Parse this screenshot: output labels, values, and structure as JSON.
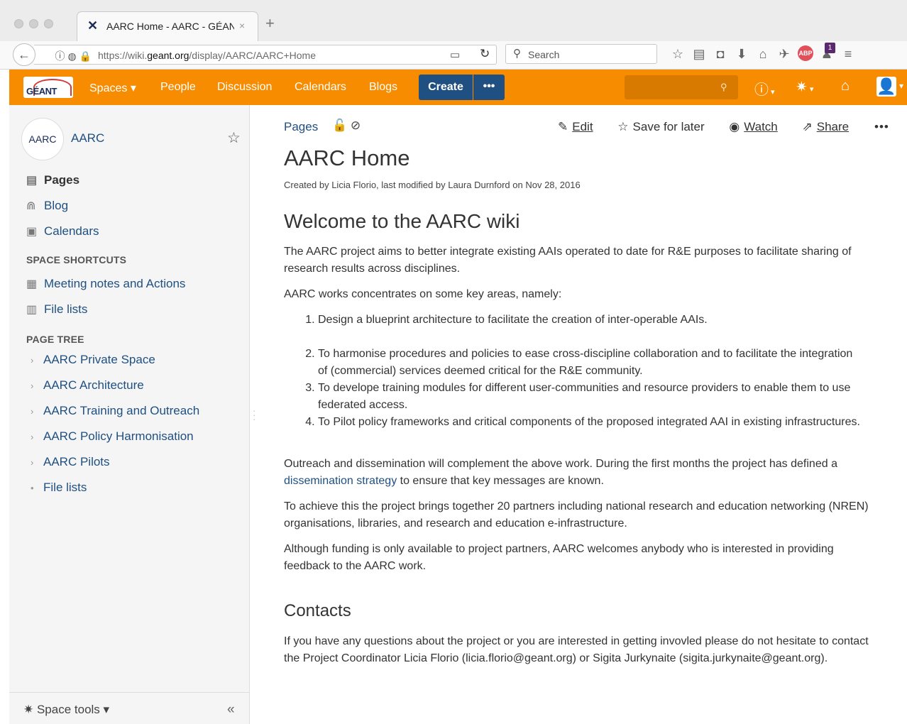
{
  "browser": {
    "tab_title": "AARC Home - AARC - GÉANT",
    "tab_close": "×",
    "new_tab": "+",
    "url_prefix": "https://wiki.",
    "url_domain": "geant.org",
    "url_path": "/display/AARC/AARC+Home",
    "search_placeholder": "Search",
    "notification_count": "1",
    "abp_label": "ABP"
  },
  "header": {
    "logo_text": "GÉANT",
    "nav": [
      "Spaces ▾",
      "People",
      "Discussion",
      "Calendars",
      "Blogs"
    ],
    "create_label": "Create",
    "more_label": "•••",
    "brand_color": "#f88c00",
    "create_color": "#205081"
  },
  "sidebar": {
    "space_logo_text": "AARC",
    "space_name": "AARC",
    "links": [
      {
        "label": "Pages",
        "icon": "pages-icon"
      },
      {
        "label": "Blog",
        "icon": "blog-icon"
      },
      {
        "label": "Calendars",
        "icon": "calendar-icon"
      }
    ],
    "shortcuts_heading": "SPACE SHORTCUTS",
    "shortcuts": [
      {
        "label": "Meeting notes and Actions",
        "icon": "meeting-notes-icon"
      },
      {
        "label": "File lists",
        "icon": "file-list-icon"
      }
    ],
    "page_tree_heading": "PAGE TREE",
    "page_tree": [
      {
        "label": "AARC Private Space",
        "expandable": true
      },
      {
        "label": "AARC Architecture",
        "expandable": true
      },
      {
        "label": "AARC Training and Outreach",
        "expandable": true
      },
      {
        "label": "AARC Policy Harmonisation",
        "expandable": true
      },
      {
        "label": "AARC Pilots",
        "expandable": true
      },
      {
        "label": "File lists",
        "expandable": false
      }
    ],
    "space_tools_label": "Space tools ▾",
    "collapse_label": "«"
  },
  "page": {
    "breadcrumb": "Pages",
    "actions": {
      "edit": "Edit",
      "save_for_later": "Save for later",
      "watch": "Watch",
      "share": "Share",
      "more": "•••"
    },
    "title": "AARC Home",
    "meta": "Created by Licia Florio, last modified by Laura Durnford on Nov 28, 2016",
    "welcome_heading": "Welcome to the AARC wiki",
    "intro": "The AARC project aims to better integrate existing AAIs operated to date for R&E purposes to facilitate sharing of research results across disciplines.",
    "areas_intro": "AARC works concentrates on some key areas, namely:",
    "areas": [
      "Design a blueprint architecture to facilitate the creation of inter-operable AAIs.",
      "To harmonise procedures and policies to ease cross-discipline collaboration and to facilitate the integration of (commercial) services deemed critical for the R&E community.",
      "To develope training modules for different user-communities and resource providers to enable them to use federated access.",
      "To Pilot policy frameworks and critical components of the proposed integrated AAI in existing infrastructures."
    ],
    "outreach_before": "Outreach and dissemination will complement the above work. During the first months the project has defined a ",
    "outreach_link": "dissemination strategy",
    "outreach_after": " to ensure that key messages are known.",
    "partners": "To achieve this the project brings together 20 partners including national research and education networking (NREN) organisations, libraries, and research and education e-infrastructure.",
    "funding": "Although funding is only available to project partners, AARC welcomes anybody who is interested in providing feedback to the AARC work.",
    "contacts_heading": "Contacts",
    "contacts": "If you have any questions about the project or you are interested in getting invovled please do not hesitate to contact the Project Coordinator Licia Florio (licia.florio@geant.org) or Sigita Jurkynaite (sigita.jurkynaite@geant.org)."
  }
}
